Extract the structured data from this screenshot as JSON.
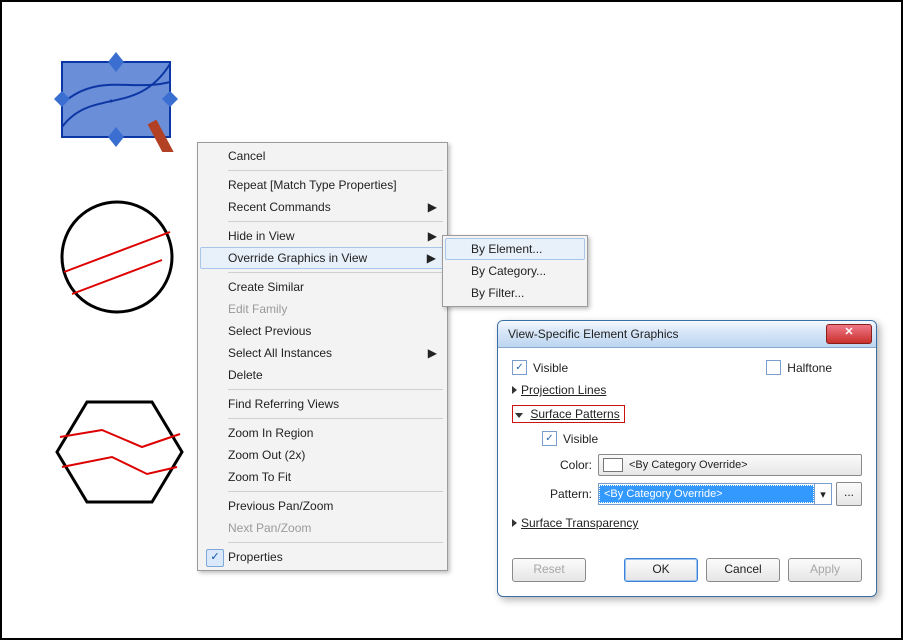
{
  "menu": {
    "cancel": "Cancel",
    "repeat": "Repeat [Match Type Properties]",
    "recent": "Recent Commands",
    "hide": "Hide in View",
    "override": "Override Graphics in View",
    "create_similar": "Create Similar",
    "edit_family": "Edit Family",
    "select_previous": "Select Previous",
    "select_all_instances": "Select All Instances",
    "delete": "Delete",
    "find_referring": "Find Referring Views",
    "zoom_in_region": "Zoom In Region",
    "zoom_out_2x": "Zoom Out (2x)",
    "zoom_to_fit": "Zoom To Fit",
    "previous_pan": "Previous Pan/Zoom",
    "next_pan": "Next Pan/Zoom",
    "properties": "Properties"
  },
  "submenu": {
    "by_element": "By Element...",
    "by_category": "By Category...",
    "by_filter": "By Filter..."
  },
  "dialog": {
    "title": "View-Specific Element Graphics",
    "visible": "Visible",
    "halftone": "Halftone",
    "projection_lines": "Projection Lines",
    "surface_patterns": "Surface Patterns",
    "sp_visible": "Visible",
    "color_label": "Color:",
    "color_value": "<By Category Override>",
    "pattern_label": "Pattern:",
    "pattern_value": "<By Category Override>",
    "surface_transparency": "Surface Transparency",
    "reset": "Reset",
    "ok": "OK",
    "cancel": "Cancel",
    "apply": "Apply"
  }
}
